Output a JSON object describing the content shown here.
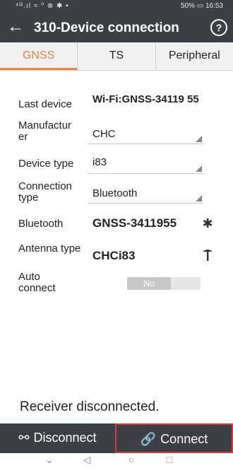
{
  "status_bar": {
    "left_icons": "⁴ᴳ.ıl ≈ ⁰ ⊗ ✱ ▪",
    "battery": "50%",
    "time": "16:53"
  },
  "header": {
    "title": "310-Device connection",
    "back_icon": "←",
    "help_icon": "?"
  },
  "tabs": [
    {
      "label": "GNSS",
      "active": true
    },
    {
      "label": "TS",
      "active": false
    },
    {
      "label": "Peripheral",
      "active": false
    }
  ],
  "form": {
    "last_device": {
      "label": "Last device",
      "value": "Wi-Fi:GNSS-34119 55"
    },
    "manufacturer": {
      "label": "Manufactur er",
      "value": "CHC"
    },
    "device_type": {
      "label": "Device type",
      "value": "i83"
    },
    "connection_type": {
      "label": "Connection type",
      "value": "Bluetooth"
    },
    "bluetooth": {
      "label": "Bluetooth",
      "value": "GNSS-3411955",
      "icon": "bluetooth-icon"
    },
    "antenna_type": {
      "label": "Antenna type",
      "value": "CHCi83",
      "icon": "antenna-icon"
    },
    "auto_connect": {
      "label": "Auto connect",
      "value": "No"
    }
  },
  "status_message": "Receiver disconnected.",
  "buttons": {
    "disconnect": "Disconnect",
    "connect": "Connect"
  },
  "nav": {
    "collapse": "⌄",
    "back": "◁",
    "home": "○",
    "recent": "□"
  },
  "colors": {
    "bar_background": "#3d3f47",
    "accent": "#e8833a",
    "highlight_border": "#d23b3b"
  }
}
